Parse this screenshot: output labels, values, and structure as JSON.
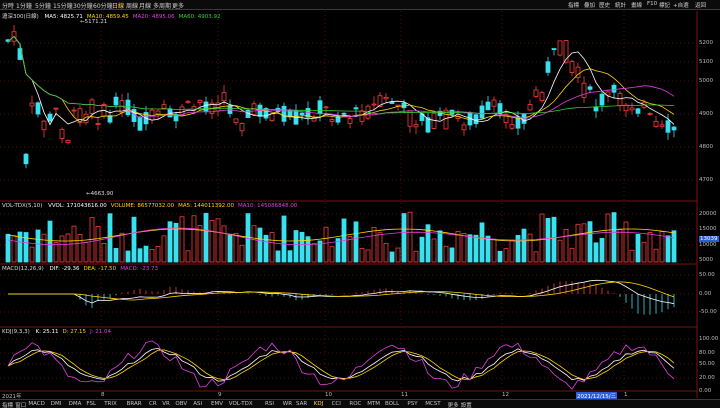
{
  "toolbar": {
    "timeframes": [
      "分時",
      "1分鐘",
      "5分鐘",
      "15分鐘",
      "30分鐘",
      "60分鐘",
      "日線",
      "周線",
      "月線",
      "多周期",
      "更多"
    ],
    "active_timeframe": "日線",
    "tools": [
      "指標",
      "疊加",
      "歷史",
      "統計",
      "畫線",
      "F10",
      "標記",
      "+自選",
      "返回"
    ]
  },
  "main_panel": {
    "title": "滬深300(日線)",
    "ma_legend": [
      {
        "label": "MA5: 4825.71",
        "color": "#ffffff"
      },
      {
        "label": "MA10: 4859.45",
        "color": "#ffd700"
      },
      {
        "label": "MA20: 4895.06",
        "color": "#e040e0"
      },
      {
        "label": "MA60: 4903.92",
        "color": "#36d036"
      }
    ],
    "high_marker": "5171.21",
    "low_marker": "4663.90",
    "y_ticks": [
      "5200",
      "5100",
      "5000",
      "4900",
      "4800",
      "4700"
    ]
  },
  "volume_panel": {
    "title": "VOL-TDX(5,10)",
    "legend": [
      {
        "label": "VVOL: 171043616.00",
        "color": "#ffffff"
      },
      {
        "label": "VOLUME: 86577032.00",
        "color": "#ffd700"
      },
      {
        "label": "MA5: 144011392.00",
        "color": "#ffd700"
      },
      {
        "label": "MA10: 145086848.00",
        "color": "#e040e0"
      }
    ],
    "y_ticks": [
      "20000",
      "15000",
      "10000",
      "5000"
    ],
    "current_label": "13039"
  },
  "macd_panel": {
    "title": "MACD(12,26,9)",
    "legend": [
      {
        "label": "DIF: -29.36",
        "color": "#ffffff"
      },
      {
        "label": "DEA: -17.50",
        "color": "#ffd700"
      },
      {
        "label": "MACD: -23.73",
        "color": "#e040e0"
      }
    ],
    "y_ticks": [
      "50.00",
      "0.00",
      "-50.00"
    ]
  },
  "kdj_panel": {
    "title": "KDJ(9,3,3)",
    "legend": [
      {
        "label": "K: 25.11",
        "color": "#ffffff"
      },
      {
        "label": "D: 27.15",
        "color": "#ffd700"
      },
      {
        "label": "J: 21.04",
        "color": "#e040e0"
      }
    ],
    "y_ticks": [
      "100.00",
      "80.00",
      "50.00",
      "20.00",
      "0.00"
    ]
  },
  "date_axis": {
    "labels": [
      "2021年",
      "8",
      "9",
      "10",
      "11",
      "12",
      "2021/12/15/三",
      "1"
    ],
    "highlight": "2021/12/15/三"
  },
  "bottom_tabs": [
    "指標",
    "窗口",
    "MACD",
    "DMI",
    "DMA",
    "FSL",
    "TRIX",
    "BRAR",
    "CR",
    "VR",
    "OBV",
    "ASI",
    "EMV",
    "VOL-TDX",
    "RSI",
    "WR",
    "SAR",
    "KDJ",
    "CCI",
    "ROC",
    "MTM",
    "BOLL",
    "PSY",
    "MCST",
    "更多",
    "設置"
  ],
  "active_tab": "KDJ",
  "colors": {
    "up": "#ff3b3b",
    "down": "#39e0f0",
    "ma5": "#ffffff",
    "ma10": "#ffd700",
    "ma20": "#e040e0",
    "ma60": "#36d036"
  }
}
